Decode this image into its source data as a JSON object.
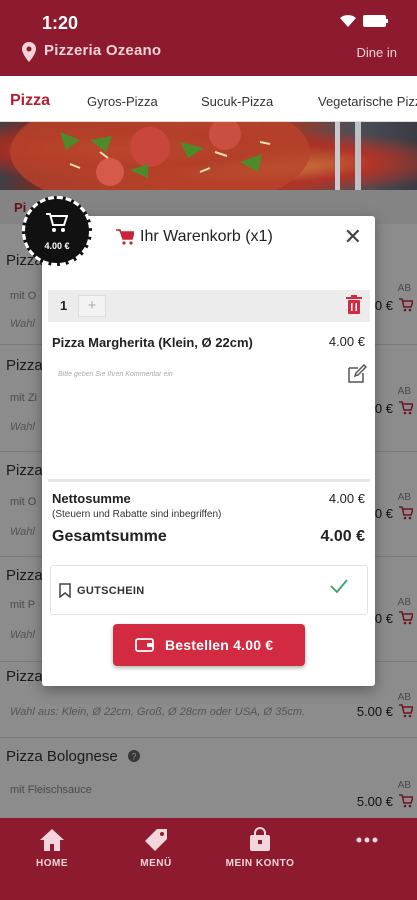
{
  "status_bar": {
    "time": "1:20"
  },
  "header": {
    "restaurant": "Pizzeria Ozeano",
    "mode": "Dine in"
  },
  "tabs": [
    "Pizza",
    "Gyros-Pizza",
    "Sucuk-Pizza",
    "Vegetarische Pizza"
  ],
  "section_label": "Pi",
  "items": [
    {
      "name": "Pizza",
      "desc": "mit O",
      "wahl": "Wahl",
      "ab": "AB",
      "price": "4.00 €"
    },
    {
      "name": "Pizza",
      "desc": "mit Zi",
      "wahl": "Wahl",
      "ab": "AB",
      "price": "4.00 €"
    },
    {
      "name": "Pizza",
      "desc": "mit O",
      "wahl": "Wahl",
      "ab": "AB",
      "price": "4.00 €"
    },
    {
      "name": "Pizza",
      "desc": "mit P",
      "wahl": "Wahl",
      "ab": "AB",
      "price": "4.00 €"
    },
    {
      "name": "Pizza",
      "desc": "",
      "wahl": "Wahl aus: Klein, Ø 22cm, Groß, Ø 28cm oder USA, Ø 35cm.",
      "ab": "AB",
      "price": "5.00 €"
    },
    {
      "name": "Pizza Bolognese",
      "desc": "mit Fleischsauce",
      "wahl": "",
      "ab": "AB",
      "price": "5.00 €"
    }
  ],
  "cart_badge": {
    "amount": "4.00 €"
  },
  "cart": {
    "title": "Ihr Warenkorb (x1)",
    "quantity": "1",
    "plus": "+",
    "product_name": "Pizza Margherita (Klein, Ø 22cm)",
    "product_price": "4.00 €",
    "comment_placeholder": "Bitte geben Sie Ihren Kommentar ein",
    "net_label": "Nettosumme",
    "net_value": "4.00 €",
    "tax_note": "(Steuern und Rabatte sind inbegriffen)",
    "total_label": "Gesamtsumme",
    "total_value": "4.00 €",
    "voucher_label": "GUTSCHEIN",
    "order_label": "Bestellen 4.00 €",
    "close": "✕"
  },
  "bottom_nav": [
    "HOME",
    "MENÜ",
    "MEIN KONTO"
  ],
  "colors": {
    "brand": "#8e1a2f",
    "accent": "#d22b41",
    "check": "#3aa56a"
  }
}
